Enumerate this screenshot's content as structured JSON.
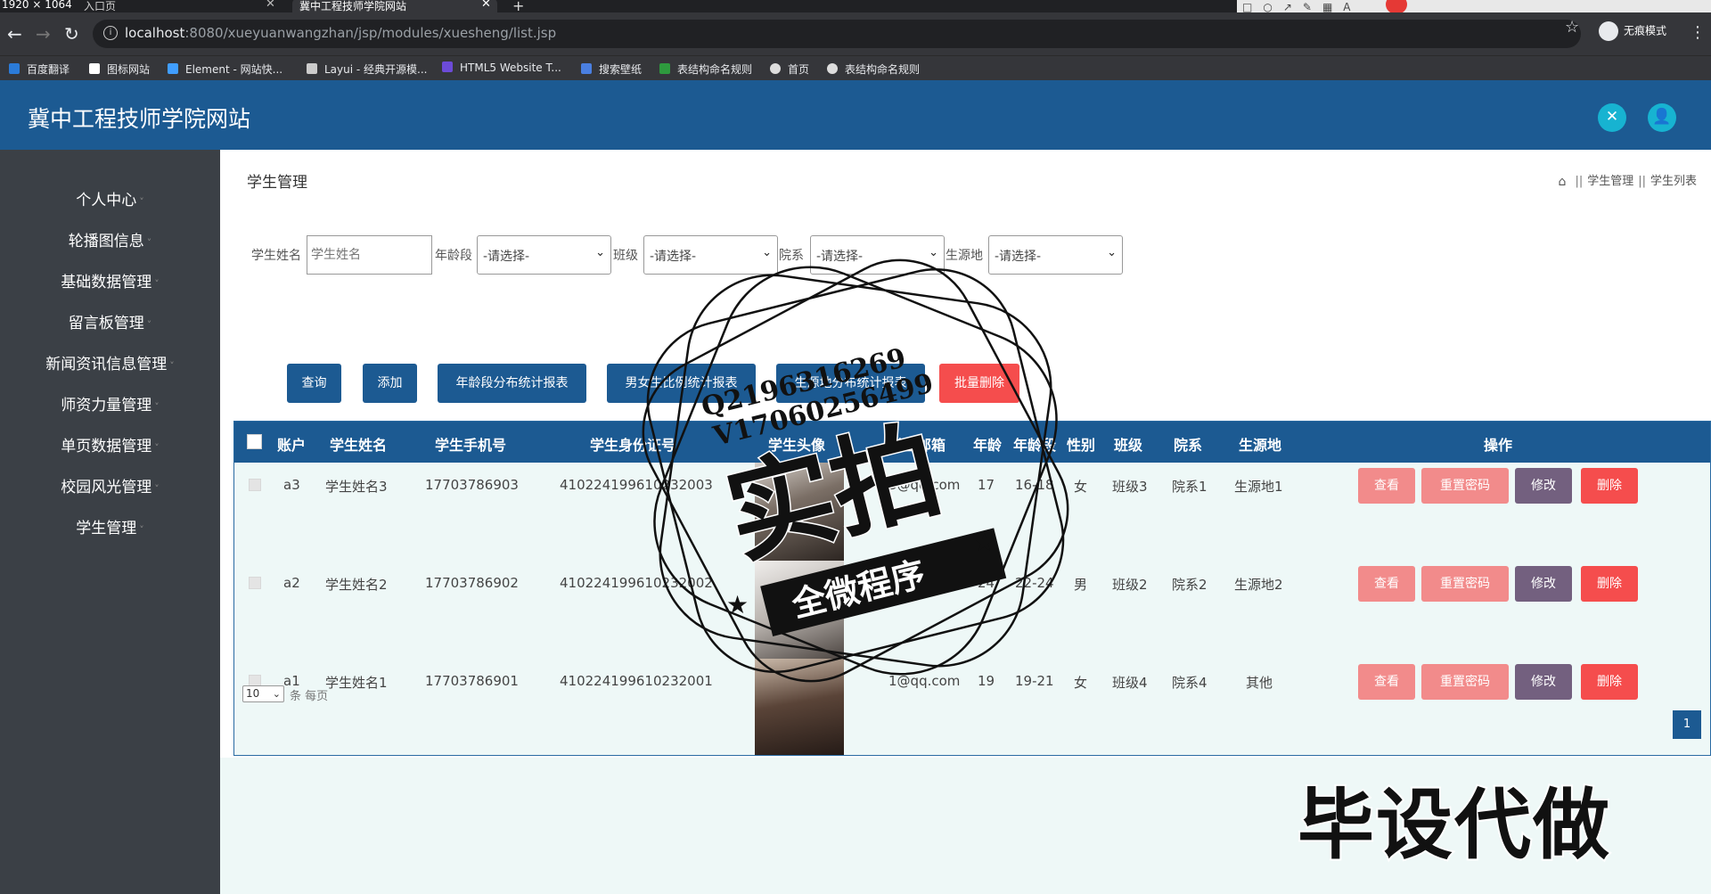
{
  "browser": {
    "resolution": "1920 × 1064",
    "tabs": [
      {
        "label": "入口页"
      },
      {
        "label": "冀中工程技师学院网站"
      }
    ],
    "url_host": "localhost",
    "url_path": ":8080/xueyuanwangzhan/jsp/modules/xuesheng/list.jsp",
    "incognito_label": "无痕模式",
    "bookmarks": [
      {
        "label": "百度翻译",
        "color": "#2b7bd8"
      },
      {
        "label": "图标网站",
        "color": "#ffffff"
      },
      {
        "label": "Element - 网站快...",
        "color": "#409eff"
      },
      {
        "label": "Layui - 经典开源模...",
        "color": "#cccccc"
      },
      {
        "label": "HTML5 Website T...",
        "color": "#6c4bd8"
      },
      {
        "label": "搜索壁纸",
        "color": "#4a7fe0"
      },
      {
        "label": "表结构命名规则",
        "color": "#2e9a3e"
      },
      {
        "label": "首页",
        "color": "#dddddd"
      },
      {
        "label": "表结构命名规则",
        "color": "#dddddd"
      }
    ]
  },
  "app": {
    "site_title": "冀中工程技师学院网站",
    "sidebar": [
      {
        "label": "个人中心"
      },
      {
        "label": "轮播图信息"
      },
      {
        "label": "基础数据管理"
      },
      {
        "label": "留言板管理"
      },
      {
        "label": "新闻资讯信息管理"
      },
      {
        "label": "师资力量管理"
      },
      {
        "label": "单页数据管理"
      },
      {
        "label": "校园风光管理"
      },
      {
        "label": "学生管理"
      }
    ],
    "page_title": "学生管理",
    "breadcrumb": [
      "学生管理",
      "学生列表"
    ],
    "filters": {
      "name_label": "学生姓名",
      "name_placeholder": "学生姓名",
      "age_label": "年龄段",
      "class_label": "班级",
      "dept_label": "院系",
      "origin_label": "生源地",
      "select_default": "-请选择-"
    },
    "buttons": {
      "search": "查询",
      "add": "添加",
      "age_report": "年龄段分布统计报表",
      "gender_report": "男女生比例统计报表",
      "origin_report": "生源地分布统计报表",
      "batch_delete": "批量删除"
    },
    "table": {
      "headers": [
        "账户",
        "学生姓名",
        "学生手机号",
        "学生身份证号",
        "学生头像",
        "学生邮箱",
        "年龄",
        "年龄段",
        "性别",
        "班级",
        "院系",
        "生源地",
        "操作"
      ],
      "rows": [
        {
          "account": "a3",
          "name": "学生姓名3",
          "phone": "17703786903",
          "id_card": "410224199610232003",
          "email": "3@qq.com",
          "age": "17",
          "age_range": "16-18",
          "gender": "女",
          "class": "班级3",
          "dept": "院系1",
          "origin": "生源地1"
        },
        {
          "account": "a2",
          "name": "学生姓名2",
          "phone": "17703786902",
          "id_card": "410224199610232002",
          "email": "2@qq.com",
          "age": "24",
          "age_range": "22-24",
          "gender": "男",
          "class": "班级2",
          "dept": "院系2",
          "origin": "生源地2"
        },
        {
          "account": "a1",
          "name": "学生姓名1",
          "phone": "17703786901",
          "id_card": "410224199610232001",
          "email": "1@qq.com",
          "age": "19",
          "age_range": "19-21",
          "gender": "女",
          "class": "班级4",
          "dept": "院系4",
          "origin": "其他"
        }
      ],
      "actions": {
        "view": "查看",
        "reset": "重置密码",
        "edit": "修改",
        "delete": "删除"
      }
    },
    "pagination": {
      "page_size": "10",
      "page_size_label": "条 每页",
      "current_page": "1"
    }
  },
  "watermark": {
    "qq": "Q2196316269",
    "wechat": "V17060256499",
    "stamp_main": "实拍",
    "stamp_ribbon": "全微程序",
    "corner_text": "毕设代做"
  },
  "colors": {
    "header": "#1c5a92",
    "sidebar": "#3b4046",
    "header_icon": "#17b3d1",
    "danger": "#f54d4d",
    "pink": "#f28b8b",
    "edit": "#73607f"
  }
}
